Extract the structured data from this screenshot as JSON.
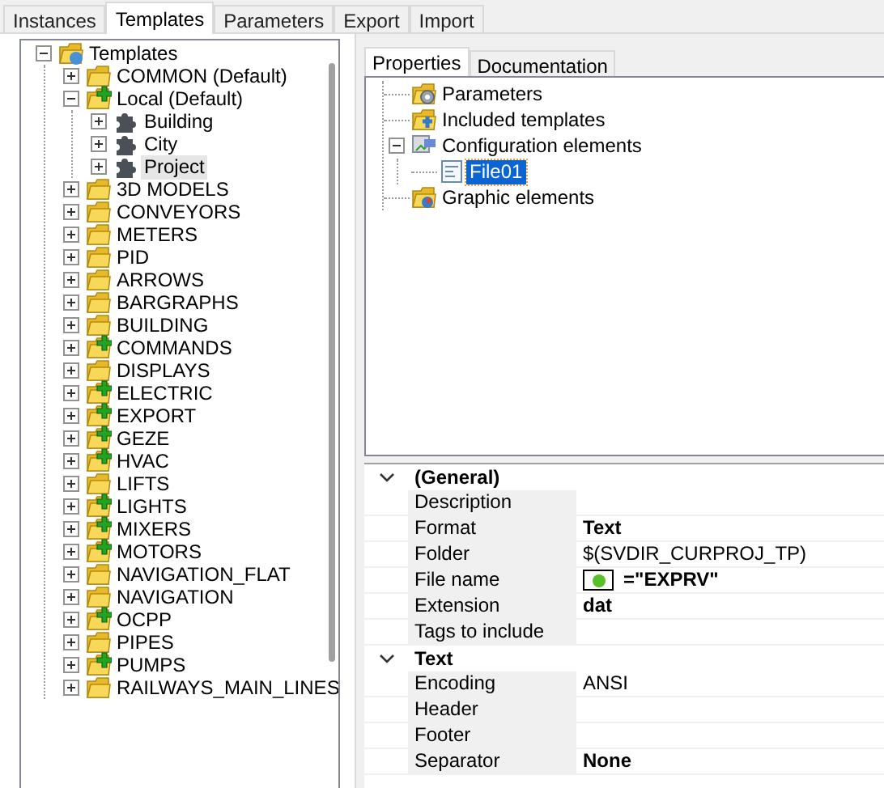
{
  "tabs": [
    {
      "label": "Instances",
      "selected": false
    },
    {
      "label": "Templates",
      "selected": true
    },
    {
      "label": "Parameters",
      "selected": false
    },
    {
      "label": "Export",
      "selected": false
    },
    {
      "label": "Import",
      "selected": false
    }
  ],
  "template_tree": {
    "label": "Templates",
    "kind": "root",
    "expanded": true,
    "selected": false,
    "children": [
      {
        "label": "COMMON (Default)",
        "kind": "folder",
        "expanded": false,
        "selected": false
      },
      {
        "label": "Local (Default)",
        "kind": "folder_plus",
        "expanded": true,
        "selected": false,
        "children": [
          {
            "label": "Building",
            "kind": "puzzle",
            "expanded": false,
            "selected": false
          },
          {
            "label": "City",
            "kind": "puzzle",
            "expanded": false,
            "selected": false
          },
          {
            "label": "Project",
            "kind": "puzzle",
            "expanded": false,
            "selected": true
          }
        ]
      },
      {
        "label": "3D MODELS",
        "kind": "folder",
        "expanded": false,
        "selected": false
      },
      {
        "label": "CONVEYORS",
        "kind": "folder",
        "expanded": false,
        "selected": false
      },
      {
        "label": "METERS",
        "kind": "folder",
        "expanded": false,
        "selected": false
      },
      {
        "label": "PID",
        "kind": "folder",
        "expanded": false,
        "selected": false
      },
      {
        "label": "ARROWS",
        "kind": "folder",
        "expanded": false,
        "selected": false
      },
      {
        "label": "BARGRAPHS",
        "kind": "folder",
        "expanded": false,
        "selected": false
      },
      {
        "label": "BUILDING",
        "kind": "folder",
        "expanded": false,
        "selected": false
      },
      {
        "label": "COMMANDS",
        "kind": "folder_plus",
        "expanded": false,
        "selected": false
      },
      {
        "label": "DISPLAYS",
        "kind": "folder",
        "expanded": false,
        "selected": false
      },
      {
        "label": "ELECTRIC",
        "kind": "folder_plus",
        "expanded": false,
        "selected": false
      },
      {
        "label": "EXPORT",
        "kind": "folder_plus",
        "expanded": false,
        "selected": false
      },
      {
        "label": "GEZE",
        "kind": "folder_plus",
        "expanded": false,
        "selected": false
      },
      {
        "label": "HVAC",
        "kind": "folder_plus",
        "expanded": false,
        "selected": false
      },
      {
        "label": "LIFTS",
        "kind": "folder",
        "expanded": false,
        "selected": false
      },
      {
        "label": "LIGHTS",
        "kind": "folder_plus",
        "expanded": false,
        "selected": false
      },
      {
        "label": "MIXERS",
        "kind": "folder_plus",
        "expanded": false,
        "selected": false
      },
      {
        "label": "MOTORS",
        "kind": "folder_plus",
        "expanded": false,
        "selected": false
      },
      {
        "label": "NAVIGATION_FLAT",
        "kind": "folder",
        "expanded": false,
        "selected": false
      },
      {
        "label": "NAVIGATION",
        "kind": "folder",
        "expanded": false,
        "selected": false
      },
      {
        "label": "OCPP",
        "kind": "folder_plus",
        "expanded": false,
        "selected": false
      },
      {
        "label": "PIPES",
        "kind": "folder",
        "expanded": false,
        "selected": false
      },
      {
        "label": "PUMPS",
        "kind": "folder_plus",
        "expanded": false,
        "selected": false
      },
      {
        "label": "RAILWAYS_MAIN_LINES",
        "kind": "folder",
        "expanded": false,
        "selected": false
      }
    ]
  },
  "detail_tabs": [
    {
      "label": "Properties",
      "selected": true
    },
    {
      "label": "Documentation",
      "selected": false
    }
  ],
  "element_tree": [
    {
      "label": "Parameters",
      "kind": "folder_gear",
      "selected": false
    },
    {
      "label": "Included templates",
      "kind": "folder_link",
      "selected": false
    },
    {
      "label": "Configuration elements",
      "kind": "config",
      "expanded": true,
      "selected": false,
      "children": [
        {
          "label": "File01",
          "kind": "file",
          "selected": true
        }
      ]
    },
    {
      "label": "Graphic elements",
      "kind": "folder_graphic",
      "selected": false
    }
  ],
  "property_grid": [
    {
      "category": "(General)",
      "expanded": true,
      "rows": [
        {
          "name": "Description"
        },
        {
          "name": "Format",
          "value": "Text",
          "bold": true
        },
        {
          "name": "Folder",
          "value": "$(SVDIR_CURPROJ_TP)",
          "bold": false
        },
        {
          "name": "File name",
          "value": "=\"EXPRV\"",
          "bold": true,
          "kind": "expression"
        },
        {
          "name": "Extension",
          "value": "dat",
          "bold": true
        },
        {
          "name": "Tags to include"
        }
      ]
    },
    {
      "category": "Text",
      "expanded": true,
      "rows": [
        {
          "name": "Encoding",
          "value": "ANSI",
          "bold": false
        },
        {
          "name": "Header"
        },
        {
          "name": "Footer"
        },
        {
          "name": "Separator",
          "value": "None",
          "bold": true
        }
      ]
    }
  ]
}
